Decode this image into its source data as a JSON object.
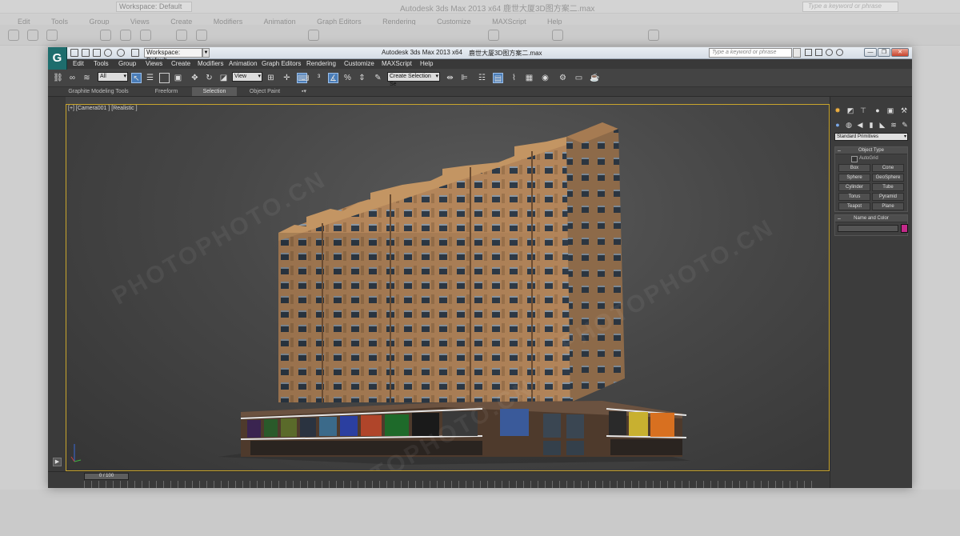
{
  "background_window": {
    "title": "Autodesk 3ds Max  2013 x64    鹿世大厦3D图方案二.max",
    "workspace": "Workspace: Default",
    "search_placeholder": "Type a keyword or phrase",
    "menu": [
      "Edit",
      "Tools",
      "Group",
      "Views",
      "Create",
      "Modifiers",
      "Animation",
      "Graph Editors",
      "Rendering",
      "Customize",
      "MAXScript",
      "Help"
    ]
  },
  "titlebar": {
    "app_logo": "G",
    "workspace": "Workspace: Default",
    "app_title": "Autodesk 3ds Max   2013  x64",
    "file_title": "鹿世大厦3D图方案二.max",
    "search_placeholder": "Type a keyword or phrase",
    "window_buttons": [
      "—",
      "❐",
      "✕"
    ]
  },
  "menu": [
    "Edit",
    "Tools",
    "Group",
    "Views",
    "Create",
    "Modifiers",
    "Animation",
    "Graph Editors",
    "Rendering",
    "Customize",
    "MAXScript",
    "Help"
  ],
  "toolbar": {
    "filter_value": "All",
    "ref_coord_value": "View",
    "selection_set_placeholder": "Create Selection Se"
  },
  "ribbon": {
    "tabs": [
      "Graphite Modeling Tools",
      "Freeform",
      "Selection",
      "Object Paint"
    ],
    "active_tab": "Selection"
  },
  "viewport": {
    "label": "[+] [Camera001 ] [Realistic ]",
    "subject": "highrise-apartment-building-render",
    "border_color": "#c9a52c"
  },
  "command_panel": {
    "category_dropdown": "Standard Primitives",
    "object_type": {
      "title": "Object Type",
      "autogrid": "AutoGrid",
      "buttons": [
        "Box",
        "Cone",
        "Sphere",
        "GeoSphere",
        "Cylinder",
        "Tube",
        "Torus",
        "Pyramid",
        "Teapot",
        "Plane"
      ]
    },
    "name_and_color": {
      "title": "Name and Color",
      "color": "#c42a8a"
    }
  },
  "timeline": {
    "slider_label": "0 / 100"
  },
  "watermark": {
    "text": "PHOTOPHOTO.CN"
  },
  "colors": {
    "ui_dark": "#444444",
    "accent_blue": "#4a7db8",
    "building_facade": "#b98a5e"
  }
}
